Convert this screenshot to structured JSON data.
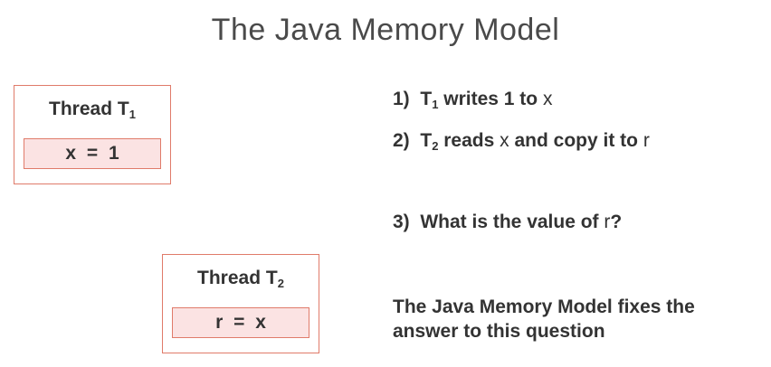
{
  "slide": {
    "title": "The Java Memory Model"
  },
  "thread1": {
    "label": "Thread T",
    "sub": "1",
    "code": "x = 1"
  },
  "thread2": {
    "label": "Thread T",
    "sub": "2",
    "code": "r = x"
  },
  "steps": [
    {
      "num": "1)",
      "subject": "T",
      "sub": "1",
      "text_a": " writes 1 to ",
      "var_a": "x",
      "text_b": "",
      "var_b": ""
    },
    {
      "num": "2)",
      "subject": "T",
      "sub": "2",
      "text_a": " reads ",
      "var_a": "x",
      "text_b": " and copy it to ",
      "var_b": "r"
    },
    {
      "num": "3)",
      "text_a": "What is the value of ",
      "var_a": "r",
      "text_b": "?"
    }
  ],
  "conclusion": "The Java Memory Model fixes the answer to this question",
  "colors": {
    "border": "#e07b6a",
    "cell_fill": "#fbe3e3",
    "text": "#333333"
  }
}
